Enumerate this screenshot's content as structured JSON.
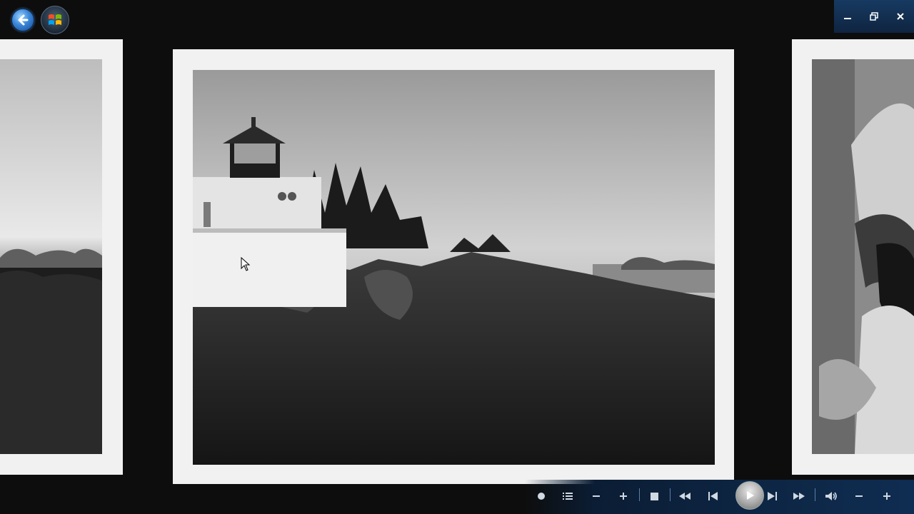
{
  "titlebar": {
    "back_icon": "back-arrow-icon",
    "start_icon": "windows-orb-icon",
    "controls": [
      "minimize-icon",
      "restore-icon",
      "close-icon"
    ]
  },
  "photos": {
    "left": "coastline-photo",
    "main": "lighthouse-photo",
    "right": "pixelated-closeup-photo"
  },
  "playback": {
    "icons": [
      "record-icon",
      "list-icon",
      "zoom-out-icon",
      "zoom-in-icon",
      "stop-icon",
      "rewind-icon",
      "previous-icon",
      "play-icon",
      "next-icon",
      "fast-forward-icon",
      "volume-icon",
      "volume-down-icon",
      "volume-up-icon"
    ]
  },
  "colors": {
    "background": "#0d0d0d",
    "frame": "#f1f1f1",
    "accent": "#0f2d52"
  }
}
